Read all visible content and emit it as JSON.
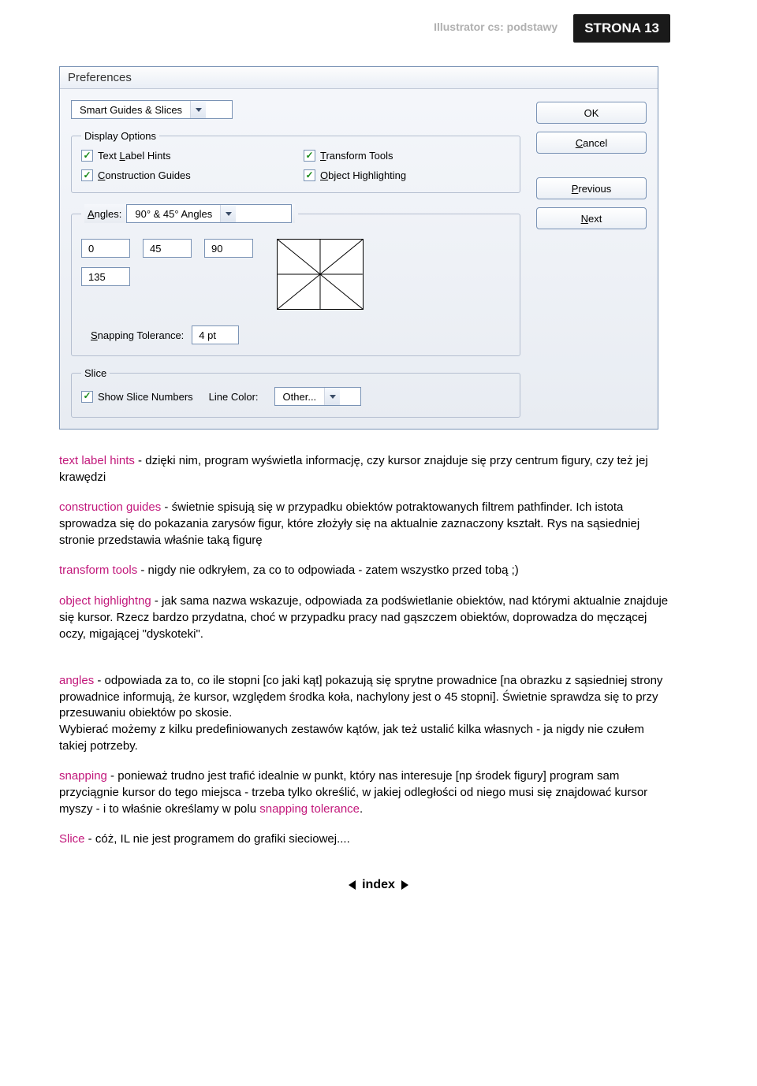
{
  "header": {
    "doc_title": "Illustrator cs: podstawy",
    "page_badge": "STRONA 13"
  },
  "dialog": {
    "title": "Preferences",
    "category_select": "Smart Guides & Slices",
    "buttons": {
      "ok": "OK",
      "cancel": "Cancel",
      "previous": "Previous",
      "next": "Next"
    },
    "display_options": {
      "legend": "Display Options",
      "text_label_hints_pre": "Text ",
      "text_label_hints_ul": "L",
      "text_label_hints_post": "abel Hints",
      "transform_tools_ul": "T",
      "transform_tools_post": "ransform Tools",
      "construction_guides_ul": "C",
      "construction_guides_post": "onstruction Guides",
      "object_highlighting_ul": "O",
      "object_highlighting_post": "bject Highlighting"
    },
    "angles": {
      "legend_pre": "",
      "legend_ul": "A",
      "legend_post": "ngles:",
      "select": "90° & 45° Angles",
      "v0": "0",
      "v1": "45",
      "v2": "90",
      "v3": "135"
    },
    "snapping": {
      "label_pre": "",
      "label_ul": "S",
      "label_post": "napping Tolerance:",
      "value": "4 pt"
    },
    "slice": {
      "legend": "Slice",
      "show_numbers": "Show Slice Numbers",
      "line_color_label": "Line Color:",
      "line_color_value": "Other..."
    }
  },
  "article": {
    "p1_kw": "text label hints",
    "p1_txt": " - dzięki nim, program wyświetla informację, czy kursor znajduje się przy centrum figury, czy też jej krawędzi",
    "p2_kw": "construction guides",
    "p2_txt": " - świetnie spisują się w przypadku obiektów potraktowanych filtrem pathfinder. Ich istota sprowadza się do pokazania zarysów figur, które złożyły się na aktualnie zaznaczony kształt. Rys na sąsiedniej stronie przedstawia właśnie taką figurę",
    "p3_kw": "transform tools",
    "p3_txt": " - nigdy nie odkryłem, za co to odpowiada -  zatem wszystko przed tobą ;)",
    "p4_kw": "object highlightng",
    "p4_txt": " - jak sama nazwa wskazuje, odpowiada za podświetlanie obiektów, nad którymi aktualnie znajduje się kursor. Rzecz bardzo przydatna, choć w przypadku pracy nad gąszczem obiektów, doprowadza do męczącej oczy, migającej \"dyskoteki\".",
    "p5_kw": "angles",
    "p5_txt": " - odpowiada  za to, co ile stopni [co jaki kąt] pokazują się sprytne prowadnice [na obrazku z sąsiedniej strony prowadnice informują, że kursor, względem środka koła, nachylony jest o 45 stopni]. Świetnie sprawdza się to przy przesuwaniu obiektów po skosie.\nWybierać możemy z kilku predefiniowanych zestawów kątów, jak też ustalić kilka własnych - ja nigdy nie czułem takiej potrzeby.",
    "p6_kw": "snapping",
    "p6_mid": " - ponieważ trudno jest trafić idealnie w punkt, który nas interesuje [np środek figury] program sam przyciągnie kursor do tego miejsca - trzeba tylko określić, w jakiej odległości od niego musi się znajdować kursor myszy - i to właśnie określamy w polu ",
    "p6_kw2": "snapping tolerance",
    "p6_end": ".",
    "p7_kw": "Slice",
    "p7_txt": " - cóż, IL nie jest programem do grafiki sieciowej...."
  },
  "footer": {
    "label": "index"
  }
}
